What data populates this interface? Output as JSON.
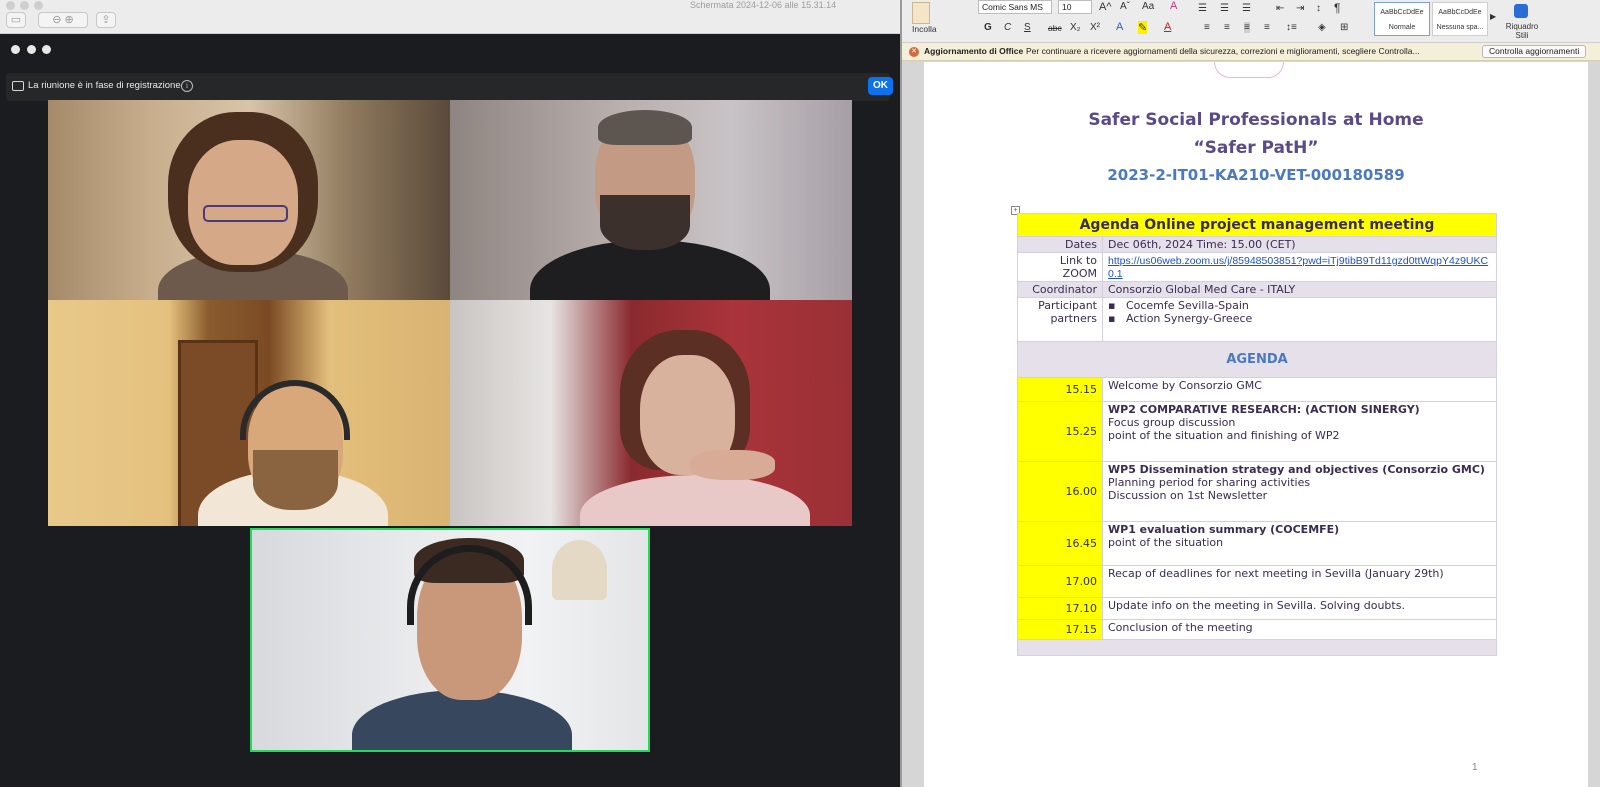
{
  "preview": {
    "title": "Schermata 2024-12-06 alle 15.31.14"
  },
  "zoom": {
    "recording_banner": "La riunione è in fase di registrazione",
    "info_symbol": "i",
    "ok_label": "OK",
    "participants": [
      {
        "id": "woman-glasses"
      },
      {
        "id": "man-beard-dark"
      },
      {
        "id": "man-headphones-beard"
      },
      {
        "id": "woman-hand-chin"
      },
      {
        "id": "man-headphones-active",
        "active_speaker": true
      }
    ]
  },
  "word": {
    "ribbon": {
      "paste_label": "Incolla",
      "font_name": "Comic Sans MS",
      "font_size": "10",
      "bold": "G",
      "italic": "C",
      "underline": "S",
      "strikethrough": "abc",
      "subscript": "X₂",
      "superscript": "X²",
      "style_normal_preview": "AaBbCcDdEe",
      "style_normal_label": "Normale",
      "style_nospacing_preview": "AaBbCcDdEe",
      "style_nospacing_label": "Nessuna spa...",
      "style_pane_label": "Riquadro Stili",
      "pilcrow": "¶"
    },
    "update_bar": {
      "title": "Aggiornamento di Office",
      "message": "Per continuare a ricevere aggiornamenti della sicurezza, correzioni e miglioramenti, scegliere Controlla...",
      "button": "Controlla aggiornamenti"
    },
    "document": {
      "title_line1": "Safer Social Professionals at Home",
      "title_line2": "“Safer PatH”",
      "project_code": "2023-2-IT01-KA210-VET-000180589",
      "agenda_heading": "Agenda Online project management meeting",
      "dates_label": "Dates",
      "dates_value": "Dec 06th, 2024 Time: 15.00 (CET)",
      "link_label_1": "Link to",
      "link_label_2": "ZOOM",
      "link_value": "https://us06web.zoom.us/j/85948503851?pwd=iTj9tibB9Td11gzd0ttWqpY4z9UKC0.1",
      "coordinator_label": "Coordinator",
      "coordinator_value": "Consorzio Global Med Care - ITALY",
      "participant_label_1": "Participant",
      "participant_label_2": "partners",
      "partner_1": "Cocemfe Sevilla-Spain",
      "partner_2": "Action Synergy-Greece",
      "agenda_title": "AGENDA",
      "items": [
        {
          "time": "15.15",
          "title": "",
          "lines": [
            "Welcome by Consorzio GMC"
          ]
        },
        {
          "time": "15.25",
          "title": "WP2 COMPARATIVE RESEARCH: (ACTION SINERGY)",
          "lines": [
            "Focus group discussion",
            "point of the situation and finishing of WP2"
          ]
        },
        {
          "time": "16.00",
          "title": "WP5 Dissemination strategy and objectives (Consorzio GMC)",
          "lines": [
            "Planning period for sharing activities",
            "Discussion on 1st Newsletter"
          ]
        },
        {
          "time": "16.45",
          "title": "WP1 evaluation summary (COCEMFE)",
          "lines": [
            "point of the situation"
          ]
        },
        {
          "time": "17.00",
          "title": "",
          "lines": [
            "Recap of deadlines for next meeting in Sevilla (January 29th)"
          ]
        },
        {
          "time": "17.10",
          "title": "",
          "lines": [
            "Update info on the meeting in Sevilla. Solving doubts."
          ]
        },
        {
          "time": "17.15",
          "title": "",
          "lines": [
            "Conclusion of the meeting"
          ]
        }
      ],
      "page_number": "1"
    }
  }
}
